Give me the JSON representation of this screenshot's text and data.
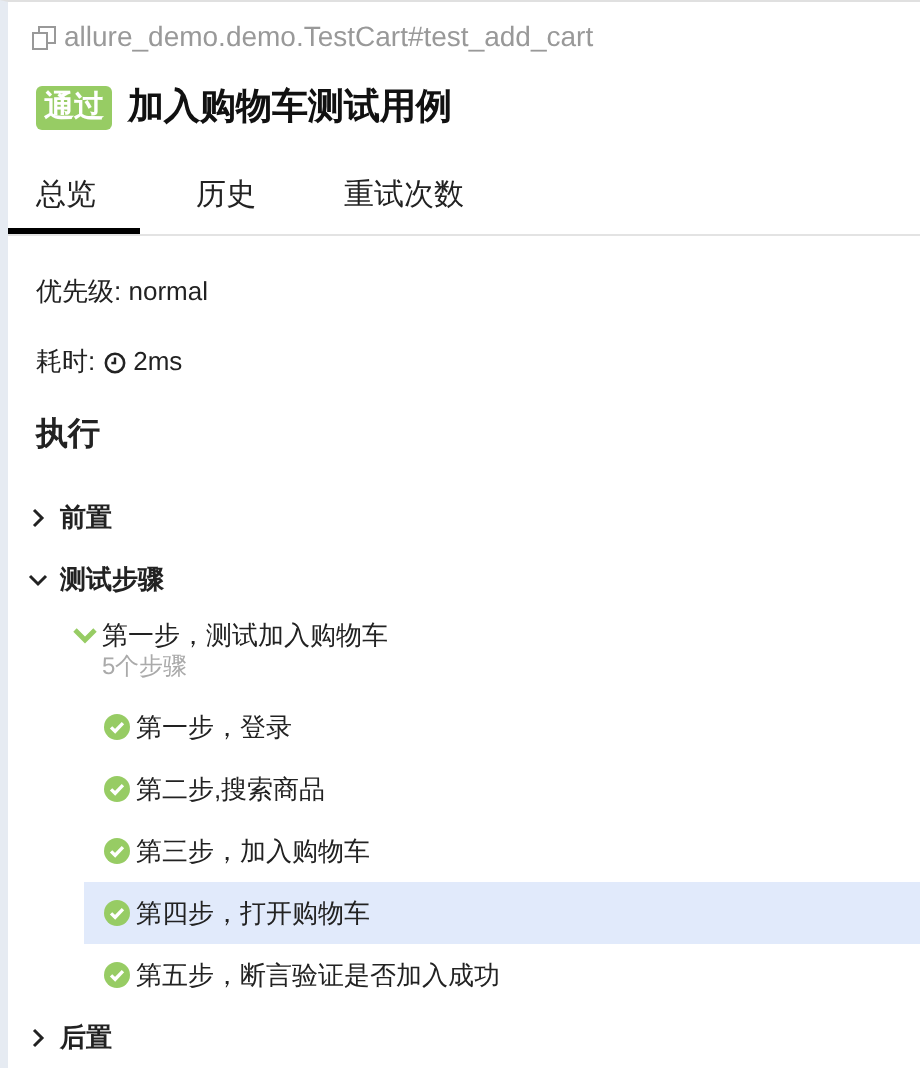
{
  "test_path": "allure_demo.demo.TestCart#test_add_cart",
  "status": {
    "kind": "passed",
    "label": "通过"
  },
  "title": "加入购物车测试用例",
  "tabs": [
    {
      "label": "总览",
      "selected": true
    },
    {
      "label": "历史",
      "selected": false
    },
    {
      "label": "重试次数",
      "selected": false
    }
  ],
  "priority": {
    "label": "优先级:",
    "value": "normal"
  },
  "duration": {
    "label": "耗时:",
    "value": "2ms"
  },
  "execution": {
    "heading": "执行",
    "sections": [
      {
        "title": "前置",
        "expanded": false
      },
      {
        "title": "测试步骤",
        "expanded": true,
        "steps": [
          {
            "name": "第一步，测试加入购物车",
            "expanded": true,
            "count": "5个步骤",
            "children": [
              {
                "name": "第一步，登录",
                "kind": "passed",
                "selected": false
              },
              {
                "name": "第二步,搜索商品",
                "kind": "passed",
                "selected": false
              },
              {
                "name": "第三步，加入购物车",
                "kind": "passed",
                "selected": false
              },
              {
                "name": "第四步，打开购物车",
                "kind": "passed",
                "selected": true
              },
              {
                "name": "第五步，断言验证是否加入成功",
                "kind": "passed",
                "selected": false
              }
            ]
          }
        ]
      },
      {
        "title": "后置",
        "expanded": false
      }
    ]
  }
}
